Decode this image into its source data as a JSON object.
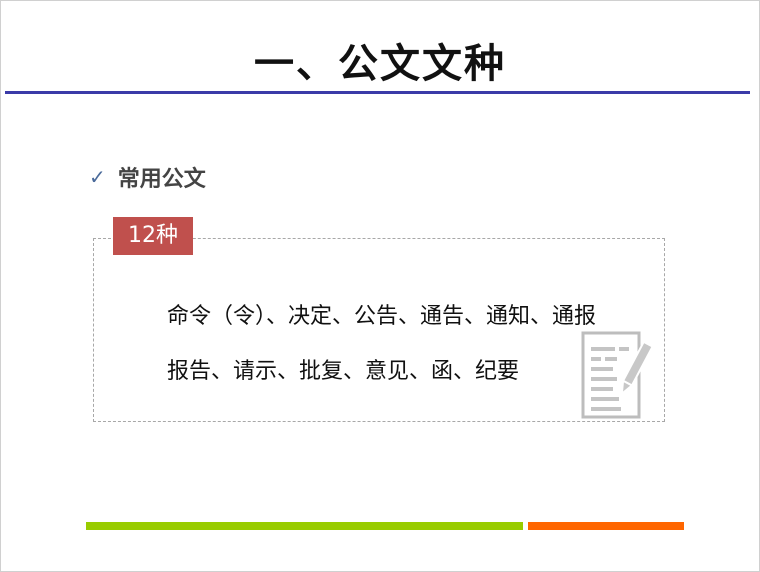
{
  "slide": {
    "title": "一、公文文种",
    "section_label": "常用公文",
    "badge": "12种",
    "lines": [
      "命令（令）、决定、公告、通告、通知、通报",
      "报告、请示、批复、意见、函、纪要"
    ]
  },
  "icons": {
    "bullet": "check-icon",
    "document": "document-pencil-icon"
  },
  "colors": {
    "title_rule": "#3b3ba8",
    "badge": "#c0504d",
    "bar_green": "#99cc00",
    "bar_orange": "#ff6600"
  }
}
